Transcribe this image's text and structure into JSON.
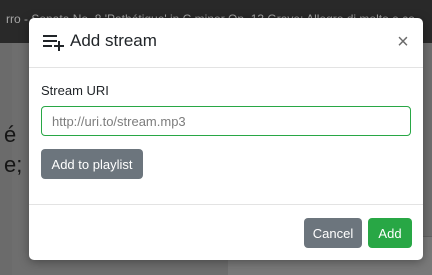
{
  "background": {
    "title_bar_text": "rro - Sonata No. 8 'Pathétique' in C minor Op. 13 Grave; Allegro di molto e co",
    "partial_text_1": "é",
    "partial_text_2": "e;"
  },
  "modal": {
    "title": "Add stream",
    "title_icon": "playlist-add-icon",
    "close_label": "×",
    "field_label": "Stream URI",
    "uri_input": {
      "value": "",
      "placeholder": "http://uri.to/stream.mp3"
    },
    "add_to_playlist_label": "Add to playlist",
    "cancel_label": "Cancel",
    "add_label": "Add"
  },
  "colors": {
    "primary_success": "#28a745",
    "secondary": "#6c757d"
  }
}
